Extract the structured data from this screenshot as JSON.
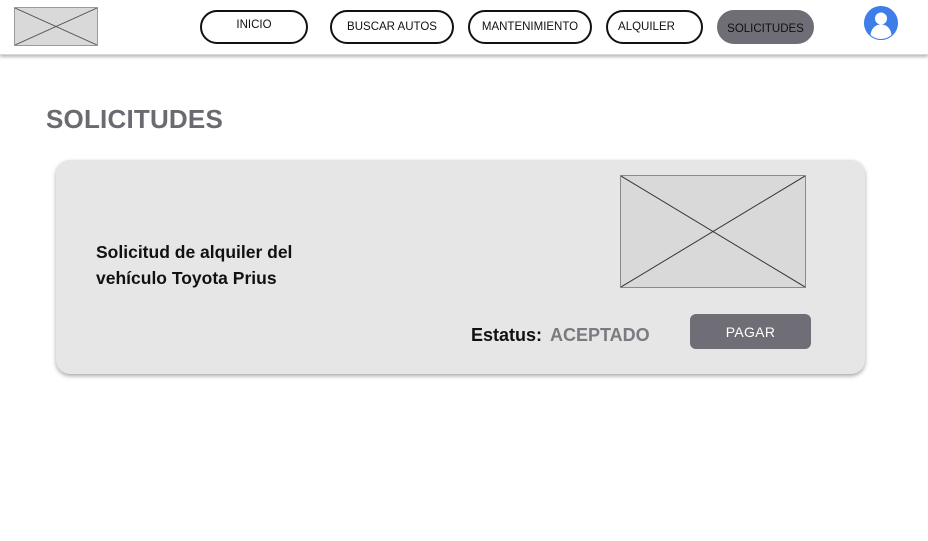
{
  "nav": {
    "items": [
      {
        "label": "INICIO"
      },
      {
        "label": "BUSCAR AUTOS"
      },
      {
        "label": "MANTENIMIENTO"
      },
      {
        "label": "ALQUILER"
      },
      {
        "label": "SOLICITUDES"
      }
    ],
    "active_item": "SOLICITUDES",
    "logo_icon": "image-placeholder-icon",
    "avatar_icon": "user-avatar-icon"
  },
  "page": {
    "title": "SOLICITUDES"
  },
  "request": {
    "description": "Solicitud de alquiler del vehículo Toyota Prius",
    "image_icon": "image-placeholder-icon",
    "status_label": "Estatus:",
    "status_value": "ACEPTADO",
    "pay_label": "PAGAR"
  },
  "colors": {
    "active_pill": "#6f6d76",
    "pay_button": "#6f6d76",
    "avatar": "#3f7ee8",
    "card_bg": "#e6e6e6",
    "title_text": "#6a6a70",
    "status_value_text": "#7a7a80"
  }
}
